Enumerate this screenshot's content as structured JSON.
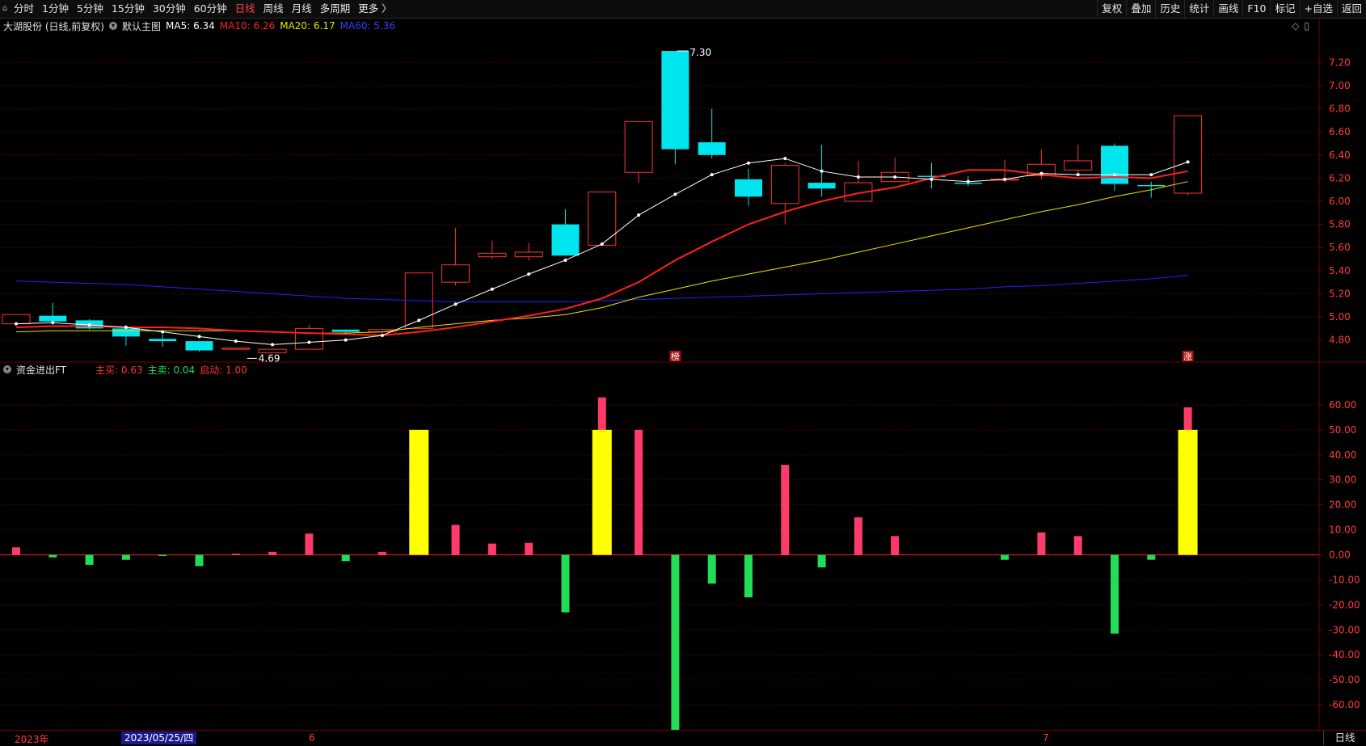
{
  "toolbar": {
    "periods": [
      "分时",
      "1分钟",
      "5分钟",
      "15分钟",
      "30分钟",
      "60分钟",
      "日线",
      "周线",
      "月线",
      "多周期",
      "更多 〉"
    ],
    "active_period": "日线",
    "right_buttons": [
      "复权",
      "叠加",
      "历史",
      "统计",
      "画线",
      "F10",
      "标记",
      "+自选",
      "返回"
    ]
  },
  "main_chart": {
    "title": "大湖股份 (日线,前复权)",
    "template": "默认主图",
    "ma5": "MA5: 6.34",
    "ma10": "MA10: 6.26",
    "ma20": "MA20: 6.17",
    "ma60": "MA60: 5.36",
    "high_label": "7.30",
    "low_label": "4.69",
    "marker_bang": "榜",
    "marker_zhang": "涨",
    "right_icons": [
      "◇",
      "▯"
    ]
  },
  "indicator": {
    "name": "资金进出FT",
    "main_buy": "主买: 0.63",
    "main_sell": "主卖: 0.04",
    "start": "启动: 1.00"
  },
  "bottom": {
    "year": "2023年",
    "selected_date": "2023/05/25/四",
    "month6": "6",
    "month7": "7",
    "period": "日线"
  },
  "colors": {
    "up": "#ff3333",
    "down": "#00e5ee",
    "ma5": "#ffffff",
    "ma10": "#ff2020",
    "ma20": "#e6e600",
    "ma60": "#2222ff",
    "buy": "#ff3b6b",
    "sell": "#22dd55",
    "start": "#ffff00"
  },
  "chart_data": {
    "type": "candlestick",
    "price_axis": {
      "ylim": [
        4.63,
        7.44
      ],
      "ticks": [
        "7.20",
        "7.00",
        "6.80",
        "6.60",
        "6.40",
        "6.20",
        "6.00",
        "5.80",
        "5.60",
        "5.40",
        "5.20",
        "5.00",
        "4.80"
      ]
    },
    "candles": [
      {
        "o": 4.94,
        "c": 5.02,
        "h": 5.02,
        "l": 4.93
      },
      {
        "o": 5.01,
        "c": 4.96,
        "h": 5.12,
        "l": 4.94
      },
      {
        "o": 4.97,
        "c": 4.9,
        "h": 4.98,
        "l": 4.89
      },
      {
        "o": 4.9,
        "c": 4.83,
        "h": 4.93,
        "l": 4.75
      },
      {
        "o": 4.81,
        "c": 4.79,
        "h": 4.85,
        "l": 4.74
      },
      {
        "o": 4.79,
        "c": 4.71,
        "h": 4.79,
        "l": 4.7
      },
      {
        "o": 4.72,
        "c": 4.73,
        "h": 4.73,
        "l": 4.72
      },
      {
        "o": 4.69,
        "c": 4.72,
        "h": 4.72,
        "l": 4.69
      },
      {
        "o": 4.72,
        "c": 4.9,
        "h": 4.93,
        "l": 4.72
      },
      {
        "o": 4.89,
        "c": 4.87,
        "h": 4.89,
        "l": 4.85
      },
      {
        "o": 4.87,
        "c": 4.89,
        "h": 4.89,
        "l": 4.86
      },
      {
        "o": 4.9,
        "c": 5.38,
        "h": 5.38,
        "l": 4.9
      },
      {
        "o": 5.3,
        "c": 5.45,
        "h": 5.77,
        "l": 5.27
      },
      {
        "o": 5.52,
        "c": 5.55,
        "h": 5.66,
        "l": 5.5
      },
      {
        "o": 5.52,
        "c": 5.56,
        "h": 5.64,
        "l": 5.49
      },
      {
        "o": 5.8,
        "c": 5.53,
        "h": 5.93,
        "l": 5.53
      },
      {
        "o": 5.62,
        "c": 6.08,
        "h": 6.08,
        "l": 5.62
      },
      {
        "o": 6.25,
        "c": 6.69,
        "h": 6.69,
        "l": 6.16
      },
      {
        "o": 7.3,
        "c": 6.45,
        "h": 7.3,
        "l": 6.32
      },
      {
        "o": 6.51,
        "c": 6.4,
        "h": 6.8,
        "l": 6.37
      },
      {
        "o": 6.19,
        "c": 6.04,
        "h": 6.28,
        "l": 5.96
      },
      {
        "o": 5.98,
        "c": 6.31,
        "h": 6.33,
        "l": 5.8
      },
      {
        "o": 6.16,
        "c": 6.11,
        "h": 6.49,
        "l": 6.04
      },
      {
        "o": 6.0,
        "c": 6.16,
        "h": 6.35,
        "l": 5.99
      },
      {
        "o": 6.17,
        "c": 6.25,
        "h": 6.38,
        "l": 6.17
      },
      {
        "o": 6.22,
        "c": 6.21,
        "h": 6.33,
        "l": 6.11
      },
      {
        "o": 6.16,
        "c": 6.15,
        "h": 6.22,
        "l": 6.13
      },
      {
        "o": 6.19,
        "c": 6.19,
        "h": 6.36,
        "l": 6.16
      },
      {
        "o": 6.22,
        "c": 6.32,
        "h": 6.45,
        "l": 6.19
      },
      {
        "o": 6.27,
        "c": 6.35,
        "h": 6.49,
        "l": 6.24
      },
      {
        "o": 6.48,
        "c": 6.15,
        "h": 6.5,
        "l": 6.09
      },
      {
        "o": 6.14,
        "c": 6.13,
        "h": 6.17,
        "l": 6.03
      },
      {
        "o": 6.07,
        "c": 6.74,
        "h": 6.74,
        "l": 6.05
      }
    ],
    "ma5": [
      4.94,
      4.95,
      4.93,
      4.91,
      4.87,
      4.83,
      4.79,
      4.76,
      4.78,
      4.8,
      4.84,
      4.97,
      5.11,
      5.24,
      5.37,
      5.49,
      5.63,
      5.88,
      6.06,
      6.23,
      6.33,
      6.37,
      6.26,
      6.21,
      6.21,
      6.19,
      6.17,
      6.19,
      6.24,
      6.23,
      6.23,
      6.23,
      6.34
    ],
    "ma10": [
      4.91,
      4.92,
      4.92,
      4.91,
      4.91,
      4.9,
      4.88,
      4.87,
      4.86,
      4.85,
      4.84,
      4.87,
      4.91,
      4.96,
      5.01,
      5.07,
      5.16,
      5.3,
      5.49,
      5.65,
      5.8,
      5.91,
      6.0,
      6.07,
      6.12,
      6.2,
      6.27,
      6.27,
      6.23,
      6.2,
      6.21,
      6.2,
      6.26
    ],
    "ma20": [
      4.87,
      4.88,
      4.88,
      4.88,
      4.88,
      4.88,
      4.88,
      4.87,
      4.86,
      4.86,
      4.87,
      4.91,
      4.94,
      4.97,
      4.99,
      5.02,
      5.08,
      5.17,
      5.24,
      5.31,
      5.37,
      5.43,
      5.49,
      5.56,
      5.63,
      5.7,
      5.77,
      5.84,
      5.91,
      5.97,
      6.04,
      6.1,
      6.17
    ],
    "ma60": [
      5.31,
      5.3,
      5.29,
      5.28,
      5.26,
      5.24,
      5.22,
      5.2,
      5.18,
      5.16,
      5.15,
      5.14,
      5.13,
      5.13,
      5.13,
      5.13,
      5.14,
      5.15,
      5.16,
      5.17,
      5.18,
      5.19,
      5.2,
      5.21,
      5.22,
      5.23,
      5.24,
      5.26,
      5.27,
      5.29,
      5.31,
      5.33,
      5.36
    ],
    "indicator_axis": {
      "ylim": [
        -70,
        70
      ],
      "ticks": [
        "60.00",
        "50.00",
        "40.00",
        "30.00",
        "20.00",
        "10.00",
        "0.00",
        "-10.00",
        "-20.00",
        "-30.00",
        "-40.00",
        "-50.00",
        "-60.00"
      ]
    },
    "fund_flow": [
      3,
      -1,
      -4,
      -2,
      -0.5,
      -4.5,
      0.5,
      1.2,
      8.5,
      -2.5,
      1.2,
      0,
      12,
      4.5,
      4.8,
      -23,
      63,
      50,
      -89,
      -11.5,
      -17,
      36,
      -5,
      15,
      7.5,
      0,
      0,
      -2,
      9,
      7.5,
      -31.5,
      -2,
      59
    ],
    "start_bars": [
      0,
      0,
      0,
      0,
      0,
      0,
      0,
      0,
      0,
      0,
      0,
      50,
      0,
      0,
      0,
      0,
      50,
      0,
      0,
      0,
      0,
      0,
      0,
      0,
      0,
      0,
      0,
      0,
      0,
      0,
      0,
      0,
      50
    ]
  }
}
